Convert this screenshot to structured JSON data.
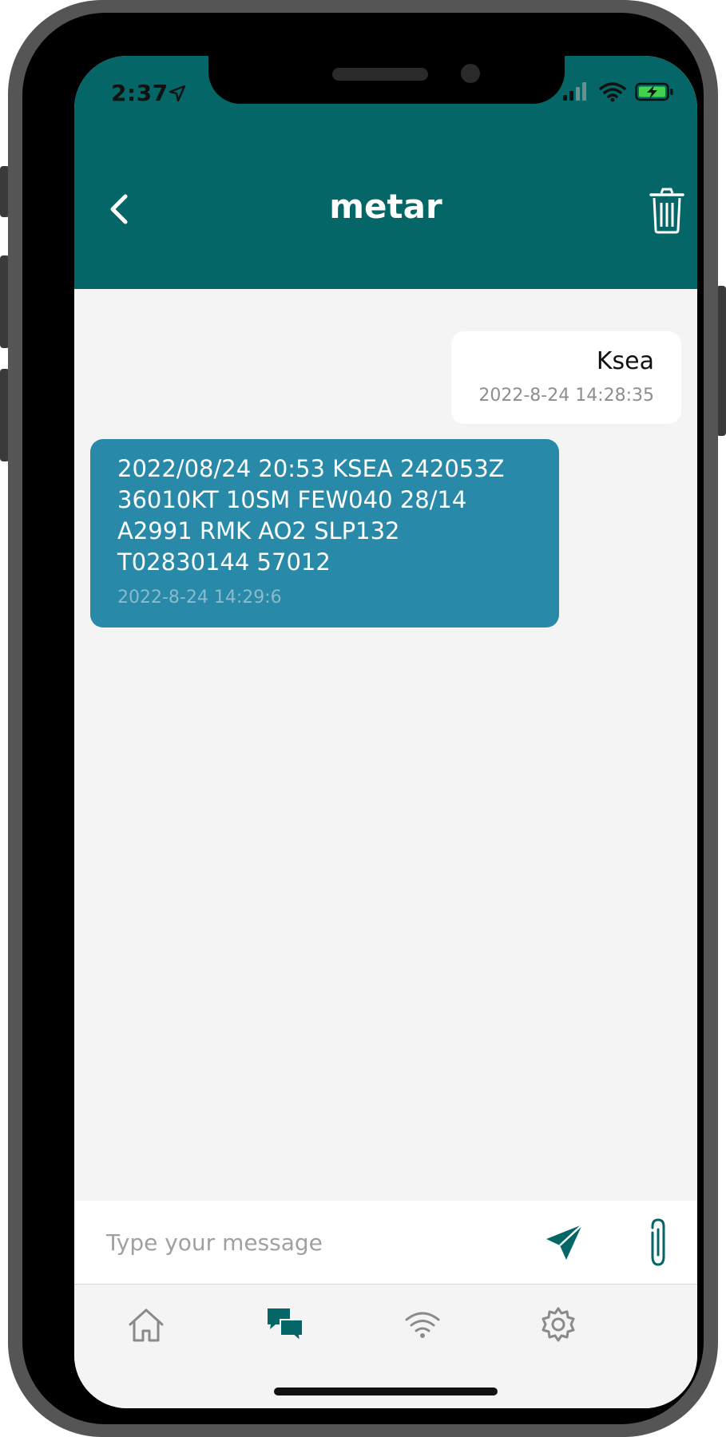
{
  "status_bar": {
    "time": "2:37",
    "icons": [
      "location-arrow-icon",
      "signal-bars-icon",
      "wifi-icon",
      "battery-charging-icon"
    ]
  },
  "header": {
    "title": "metar",
    "back_icon": "chevron-left-icon",
    "delete_icon": "trash-icon"
  },
  "messages": [
    {
      "direction": "outgoing",
      "text": "Ksea",
      "timestamp": "2022-8-24 14:28:35"
    },
    {
      "direction": "incoming",
      "text": "2022/08/24 20:53 KSEA 242053Z\n36010KT 10SM FEW040 28/14\nA2991 RMK AO2 SLP132\nT02830144 57012",
      "timestamp": "2022-8-24 14:29:6"
    }
  ],
  "composer": {
    "placeholder": "Type your message",
    "value": "",
    "send_icon": "send-icon",
    "attach_icon": "paperclip-icon"
  },
  "tab_bar": {
    "tabs": [
      {
        "icon": "home-icon",
        "active": false
      },
      {
        "icon": "chat-bubbles-icon",
        "active": true
      },
      {
        "icon": "wifi-signal-icon",
        "active": false
      },
      {
        "icon": "gear-icon",
        "active": false
      }
    ]
  },
  "colors": {
    "header": "#046666",
    "incoming_bubble": "#2989a8",
    "outgoing_bubble": "#ffffff",
    "background": "#f4f4f4",
    "accent": "#046666"
  }
}
